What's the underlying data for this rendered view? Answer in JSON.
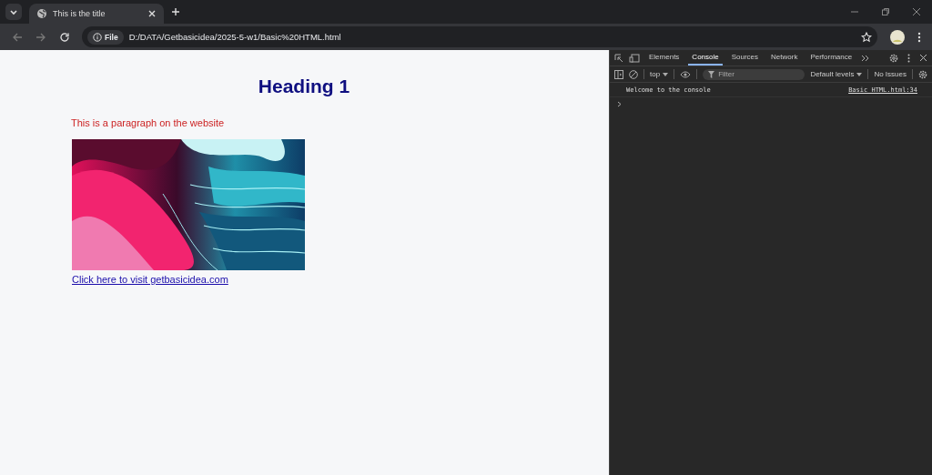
{
  "tab": {
    "title": "This is the title",
    "selected": true
  },
  "address": {
    "scheme": "File",
    "url": "D:/DATA/Getbasicidea/2025-5-w1/Basic%20HTML.html"
  },
  "page": {
    "heading": "Heading 1",
    "paragraph": "This is a paragraph on the website",
    "link": "Click here to visit getbasicidea.com"
  },
  "devtools": {
    "tabs": [
      {
        "label": "Elements",
        "selected": false
      },
      {
        "label": "Console",
        "selected": true
      },
      {
        "label": "Sources",
        "selected": false
      },
      {
        "label": "Network",
        "selected": false
      },
      {
        "label": "Performance",
        "selected": false
      }
    ],
    "context": "top",
    "filter": {
      "placeholder": "Filter"
    },
    "levels": "Default levels",
    "issues": "No Issues",
    "messages": [
      {
        "text": "Welcome to the console",
        "source": "Basic HTML.html:34"
      }
    ]
  }
}
